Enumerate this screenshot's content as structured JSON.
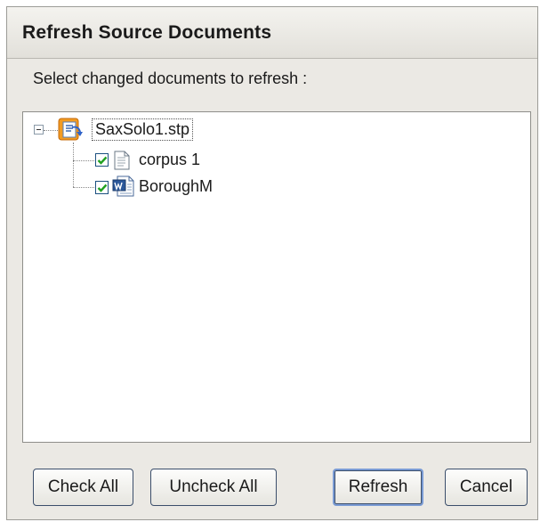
{
  "dialog": {
    "title": "Refresh Source Documents",
    "prompt": "Select changed documents to refresh :"
  },
  "tree": {
    "root": {
      "label": "SaxSolo1.stp",
      "expanded": true,
      "icon": "stp-project-icon"
    },
    "children": [
      {
        "label": "corpus 1",
        "checked": true,
        "icon": "text-document-icon"
      },
      {
        "label": "BoroughM",
        "checked": true,
        "icon": "word-document-icon"
      }
    ]
  },
  "buttons": {
    "check_all": "Check All",
    "uncheck_all": "Uncheck All",
    "refresh": "Refresh",
    "cancel": "Cancel"
  },
  "colors": {
    "dialog_bg": "#ebe9e4",
    "check_mark": "#21a121",
    "default_button_focus": "#7a9bd4"
  }
}
